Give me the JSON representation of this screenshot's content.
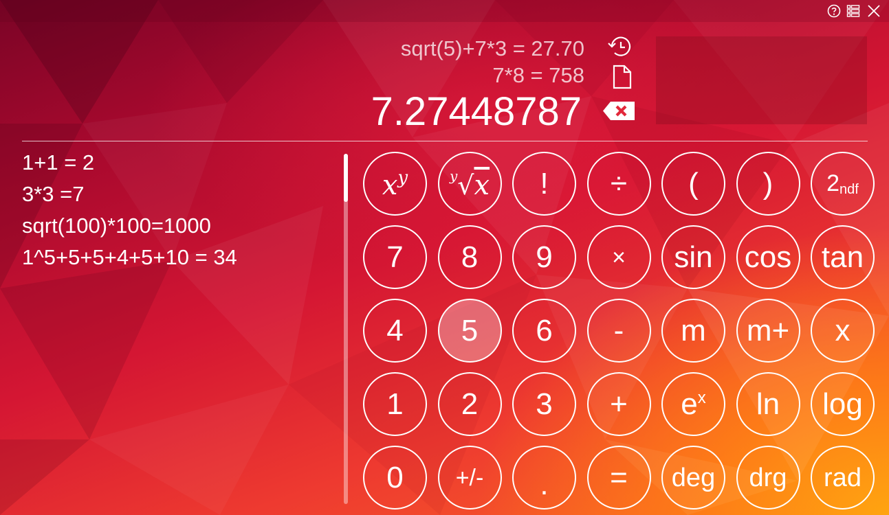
{
  "window": {
    "help_icon": "help-circle-icon",
    "menu_icon": "menu-list-icon",
    "close_icon": "close-icon"
  },
  "display": {
    "history_1": "sqrt(5)+7*3 = 27.70",
    "history_2": "7*8 = 758",
    "result": "7.27448787",
    "history_button_icon": "history-clock-icon",
    "copy_button_icon": "document-icon",
    "backspace_button_icon": "backspace-icon"
  },
  "notes": [
    "1+1 = 2",
    "3*3 =7",
    "sqrt(100)*100=1000",
    "1^5+5+5+4+5+10 = 34"
  ],
  "keypad": {
    "row1": {
      "power_base": "x",
      "power_exp": "y",
      "root_index": "y",
      "root_radicand": "x",
      "factorial": "!",
      "divide": "÷",
      "open_paren": "(",
      "close_paren": ")",
      "second_main": "2",
      "second_sub": "ndf"
    },
    "row2": {
      "k7": "7",
      "k8": "8",
      "k9": "9",
      "multiply": "×",
      "sin": "sin",
      "cos": "cos",
      "tan": "tan"
    },
    "row3": {
      "k4": "4",
      "k5": "5",
      "k6": "6",
      "minus": "-",
      "m": "m",
      "mplus": "m+",
      "x": "x"
    },
    "row4": {
      "k1": "1",
      "k2": "2",
      "k3": "3",
      "plus": "+",
      "exp_base": "e",
      "exp_power": "x",
      "ln": "ln",
      "log": "log"
    },
    "row5": {
      "k0": "0",
      "sign": "+/-",
      "dot": ".",
      "equals": "=",
      "deg": "deg",
      "drg": "drg",
      "rad": "rad"
    }
  },
  "colors": {
    "background_dark": "#7a0426",
    "background_mid": "#d41633",
    "background_light": "#ffa410",
    "key_border": "#ffffff",
    "pressed_key_fill": "rgba(255,255,255,0.32)"
  }
}
